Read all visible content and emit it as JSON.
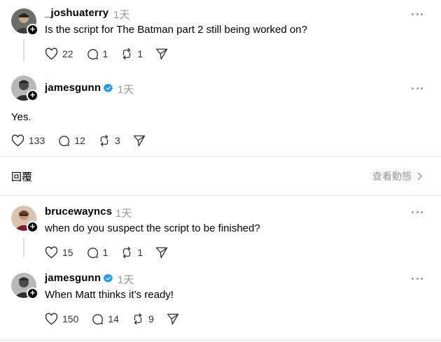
{
  "posts": [
    {
      "username": "_joshuaterry",
      "time": "1天",
      "verified": false,
      "text": "Is the script for The Batman part 2 still being worked on?",
      "likes": "22",
      "comments": "1",
      "reposts": "1"
    },
    {
      "username": "jamesgunn",
      "time": "1天",
      "verified": true,
      "text": "Yes.",
      "likes": "133",
      "comments": "12",
      "reposts": "3"
    },
    {
      "username": "brucewayncs",
      "time": "1天",
      "verified": false,
      "text": "when do you suspect the script to be finished?",
      "likes": "15",
      "comments": "1",
      "reposts": "1"
    },
    {
      "username": "jamesgunn",
      "time": "1天",
      "verified": true,
      "text": "When Matt thinks it’s ready!",
      "likes": "150",
      "comments": "14",
      "reposts": "9"
    }
  ],
  "reply_bar": {
    "label": "回覆",
    "view_activity": "查看動態"
  },
  "icons": {
    "like": "heart-icon",
    "comment": "comment-icon",
    "repost": "repost-icon",
    "share": "send-icon",
    "more": "more-icon",
    "verified": "verified-badge-icon",
    "follow": "plus-icon"
  },
  "colors": {
    "verified": "#1d9bf0",
    "muted": "#999999",
    "divider": "#e5e5e5"
  }
}
